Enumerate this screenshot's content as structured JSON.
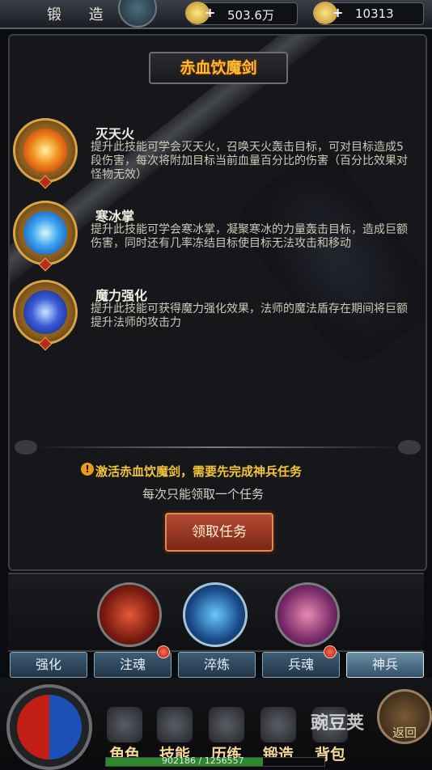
{
  "header": {
    "title": "锻 造",
    "gold": "503.6万",
    "ingots": "10313"
  },
  "panel": {
    "title": "赤血饮魔剑",
    "skills": [
      {
        "name": "灭天火",
        "desc": "提升此技能可学会灭天火，召唤天火轰击目标，可对目标造成5段伤害，每次将附加目标当前血量百分比的伤害（百分比效果对怪物无效）",
        "icon": "fire-icon"
      },
      {
        "name": "寒冰掌",
        "desc": "提升此技能可学会寒冰掌，凝聚寒冰的力量轰击目标，造成巨额伤害，同时还有几率冻结目标使目标无法攻击和移动",
        "icon": "ice-icon"
      },
      {
        "name": "魔力强化",
        "desc": "提升此技能可获得魔力强化效果，法师的魔法盾存在期间将巨额提升法师的攻击力",
        "icon": "lightning-icon"
      }
    ],
    "notice": "激活赤血饮魔剑，需要先完成神兵任务",
    "sub_notice": "每次只能领取一个任务",
    "claim_button": "领取任务"
  },
  "tabs": [
    {
      "label": "强化",
      "dot": false
    },
    {
      "label": "注魂",
      "dot": true
    },
    {
      "label": "淬炼",
      "dot": false
    },
    {
      "label": "兵魂",
      "dot": true
    },
    {
      "label": "神兵",
      "dot": false,
      "active": true
    }
  ],
  "nav": [
    "角色",
    "技能",
    "历练",
    "锻造",
    "背包"
  ],
  "return_label": "返回",
  "xp": {
    "text": "902186 / 1256557",
    "fraction": 0.718
  },
  "watermark": "豌豆荚",
  "colors": {
    "accent_gold": "#f2c53a",
    "tab_blue": "#345069",
    "button_red": "#b44a32"
  }
}
